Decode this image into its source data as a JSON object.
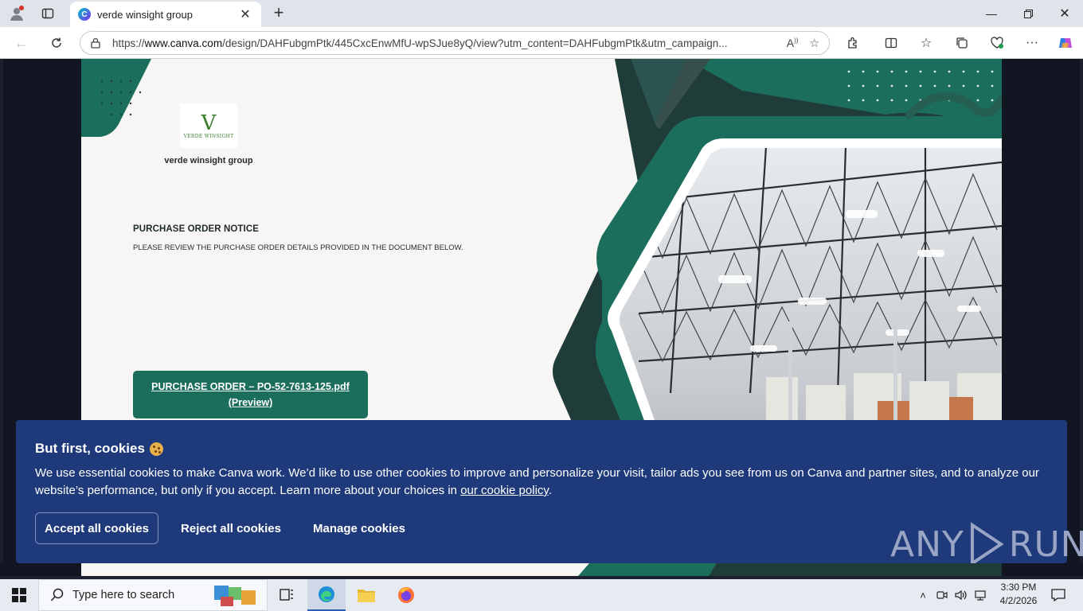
{
  "browser": {
    "tab_title": "verde winsight group",
    "url_prefix": "https://",
    "url_host": "www.canva.com",
    "url_path": "/design/DAHFubgmPtk/445CxcEnwMfU-wpSJue8yQ/view?utm_content=DAHFubgmPtk&utm_campaign..."
  },
  "design": {
    "logo_text": "VERDE WINSIGHT",
    "company_name": "verde winsight group",
    "notice_title": "PURCHASE ORDER NOTICE",
    "notice_sub": "PLEASE REVIEW THE PURCHASE ORDER DETAILS PROVIDED IN THE DOCUMENT BELOW.",
    "po_link_line1": "PURCHASE ORDER – PO-52-7613-125.pdf",
    "po_link_line2": "(Preview)",
    "colors": {
      "primary": "#1c6e5c",
      "dark": "#1f3c38",
      "bg": "#f7f6f4"
    }
  },
  "cookie_banner": {
    "title": "But first, cookies",
    "body": "We use essential cookies to make Canva work. We’d like to use other cookies to improve and personalize your visit, tailor ads you see from us on Canva and partner sites, and to analyze our website’s performance, but only if you accept. Learn more about your choices in ",
    "policy_link": "our cookie policy",
    "body_end": ".",
    "accept_label": "Accept all cookies",
    "reject_label": "Reject all cookies",
    "manage_label": "Manage cookies",
    "bg_color": "#1f3a7a"
  },
  "watermark": {
    "left": "ANY",
    "right": "RUN"
  },
  "taskbar": {
    "search_placeholder": "Type here to search",
    "time": "3:30 PM",
    "date": "4/2/2026"
  }
}
